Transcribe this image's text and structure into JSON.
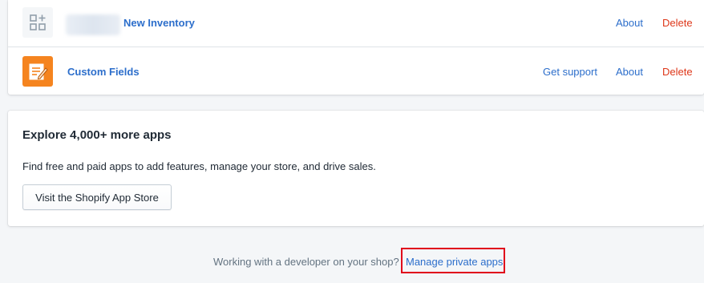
{
  "installed_apps": [
    {
      "name": "New Inventory",
      "icon": "apps-grid-icon",
      "actions": {
        "about": "About",
        "delete": "Delete"
      }
    },
    {
      "name": "Custom Fields",
      "icon": "custom-fields-icon",
      "icon_color": "#f5841f",
      "actions": {
        "support": "Get support",
        "about": "About",
        "delete": "Delete"
      }
    }
  ],
  "explore": {
    "title": "Explore 4,000+ more apps",
    "description": "Find free and paid apps to add features, manage your store, and drive sales.",
    "button_label": "Visit the Shopify App Store"
  },
  "footer": {
    "text": "Working with a developer on your shop?",
    "link": "Manage private apps",
    "highlight_color": "#e0001b"
  },
  "colors": {
    "link": "#2c6ecb",
    "delete": "#de3618",
    "background": "#f4f6f8"
  }
}
